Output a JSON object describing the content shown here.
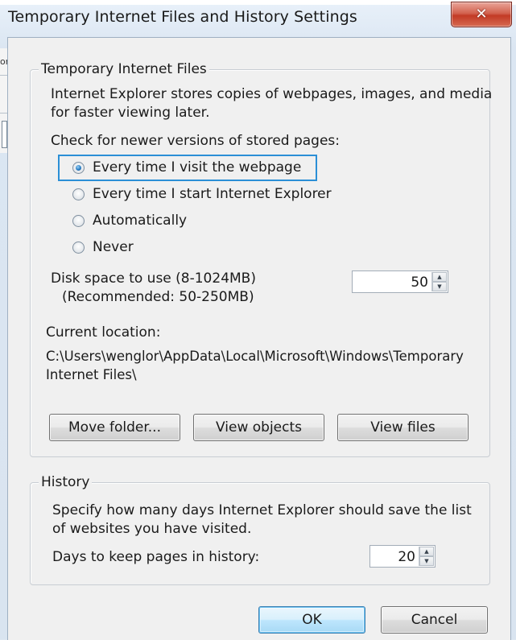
{
  "window": {
    "title": "Temporary Internet Files and History Settings",
    "close_glyph": "✕"
  },
  "background_window": {
    "edge_text": "or"
  },
  "temp_files": {
    "caption": "Temporary Internet Files",
    "description_line1": "Internet Explorer stores copies of webpages, images, and media",
    "description_line2": "for faster viewing later.",
    "check_label": "Check for newer versions of stored pages:",
    "options": [
      {
        "label": "Every time I visit the webpage",
        "selected": true
      },
      {
        "label": "Every time I start Internet Explorer",
        "selected": false
      },
      {
        "label": "Automatically",
        "selected": false
      },
      {
        "label": "Never",
        "selected": false
      }
    ],
    "disk_label_line1": "Disk space to use (8-1024MB)",
    "disk_label_line2": "(Recommended: 50-250MB)",
    "disk_value": "50",
    "current_location_label": "Current location:",
    "location_line1": "C:\\Users\\wenglor\\AppData\\Local\\Microsoft\\Windows\\Temporary",
    "location_line2": "Internet Files\\",
    "buttons": {
      "move_folder": "Move folder...",
      "view_objects": "View objects",
      "view_files": "View files"
    }
  },
  "history": {
    "caption": "History",
    "description_line1": "Specify how many days Internet Explorer should save the list",
    "description_line2": "of websites you have visited.",
    "days_label": "Days to keep pages in history:",
    "days_value": "20"
  },
  "footer": {
    "ok": "OK",
    "cancel": "Cancel"
  },
  "icons": {
    "spin_up": "▲",
    "spin_down": "▼"
  },
  "colors": {
    "focus_border": "#2b8fd6",
    "close_button": "#c23a25"
  }
}
